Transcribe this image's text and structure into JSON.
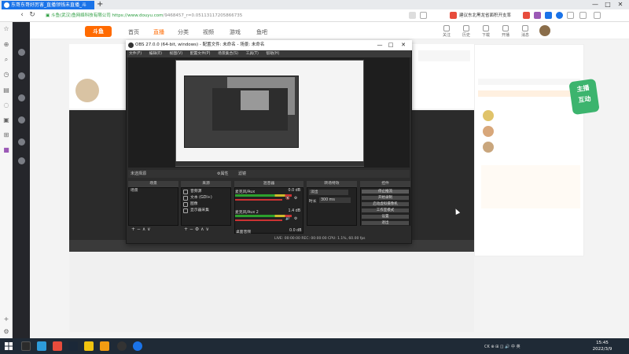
{
  "browser": {
    "tab_title": "东哥东哥好厉害_直播领钱未直播_斗",
    "new_tab": "+",
    "url_secure_label": "斗鱼(武汉)鱼网络科技有限公司",
    "url_host": "https://www.douyu.com",
    "url_path": "/9468457_r=0.05113117205866735",
    "promo_text": "建议东北黑龙省面积开支率",
    "win_min": "—",
    "win_max": "□",
    "win_close": "✕",
    "nav_back": "‹",
    "nav_forward": "›",
    "nav_refresh": "↻",
    "nav_home": "⌂"
  },
  "douyu": {
    "logo": "斗鱼",
    "nav": [
      "首页",
      "直播",
      "分类",
      "视频",
      "游戏",
      "鱼吧"
    ],
    "right_nav": [
      "关注",
      "历史",
      "下载",
      "开播",
      "消息"
    ],
    "badge_text": [
      "主播",
      "互动"
    ]
  },
  "obs": {
    "title": "OBS 27.0.0 (64-bit, windows) - 配置文件: 未命名 - 场景: 未命名",
    "min": "—",
    "max": "□",
    "close": "✕",
    "menu": [
      "文件(F)",
      "编辑(E)",
      "视图(V)",
      "配置文件(P)",
      "场景集合(S)",
      "工具(T)",
      "帮助(H)"
    ],
    "scene_bar_label": "未选择源",
    "scene_bar_props": "⚙属性",
    "scene_bar_filters": "滤镜",
    "dock_headers": [
      "场景",
      "来源",
      "混音器",
      "转场特效",
      "控件"
    ],
    "scenes": [
      "场景"
    ],
    "sources": [
      "音频源",
      "文本 (GDI+)",
      "图像",
      "显示器采集"
    ],
    "mixer": [
      {
        "name": "麦克风/Aux",
        "db": "0.0 dB"
      },
      {
        "name": "麦克风/Aux 2",
        "db": "1.4 dB"
      },
      {
        "name": "桌面音频",
        "db": "0.0 dB"
      }
    ],
    "transition": {
      "type": "淡出",
      "duration_label": "时长",
      "duration_value": "300 ms"
    },
    "controls": [
      "停止推流",
      "开始录制",
      "启动虚拟摄像机",
      "工作室模式",
      "设置",
      "退出"
    ],
    "dock_bar_symbols": "+ − ∧ ∨",
    "source_bar_symbols": "+ − ⚙ ∧ ∨",
    "status": "LIVE: 00:00:00   REC: 00:00:00   CPU: 1.1%, 60.00 fps"
  },
  "taskbar": {
    "time": "15:45",
    "date": "2022/3/9",
    "tray": "CK ⊕ ⊞ ◫ 🔊 中 英"
  },
  "colors": {
    "browser_tab": "#1a73e8",
    "douyu_brand": "#ff6a00",
    "obs_bg": "#2b2b2b",
    "meter_green": "#2ca02c",
    "taskbar": "#1f2a36"
  }
}
